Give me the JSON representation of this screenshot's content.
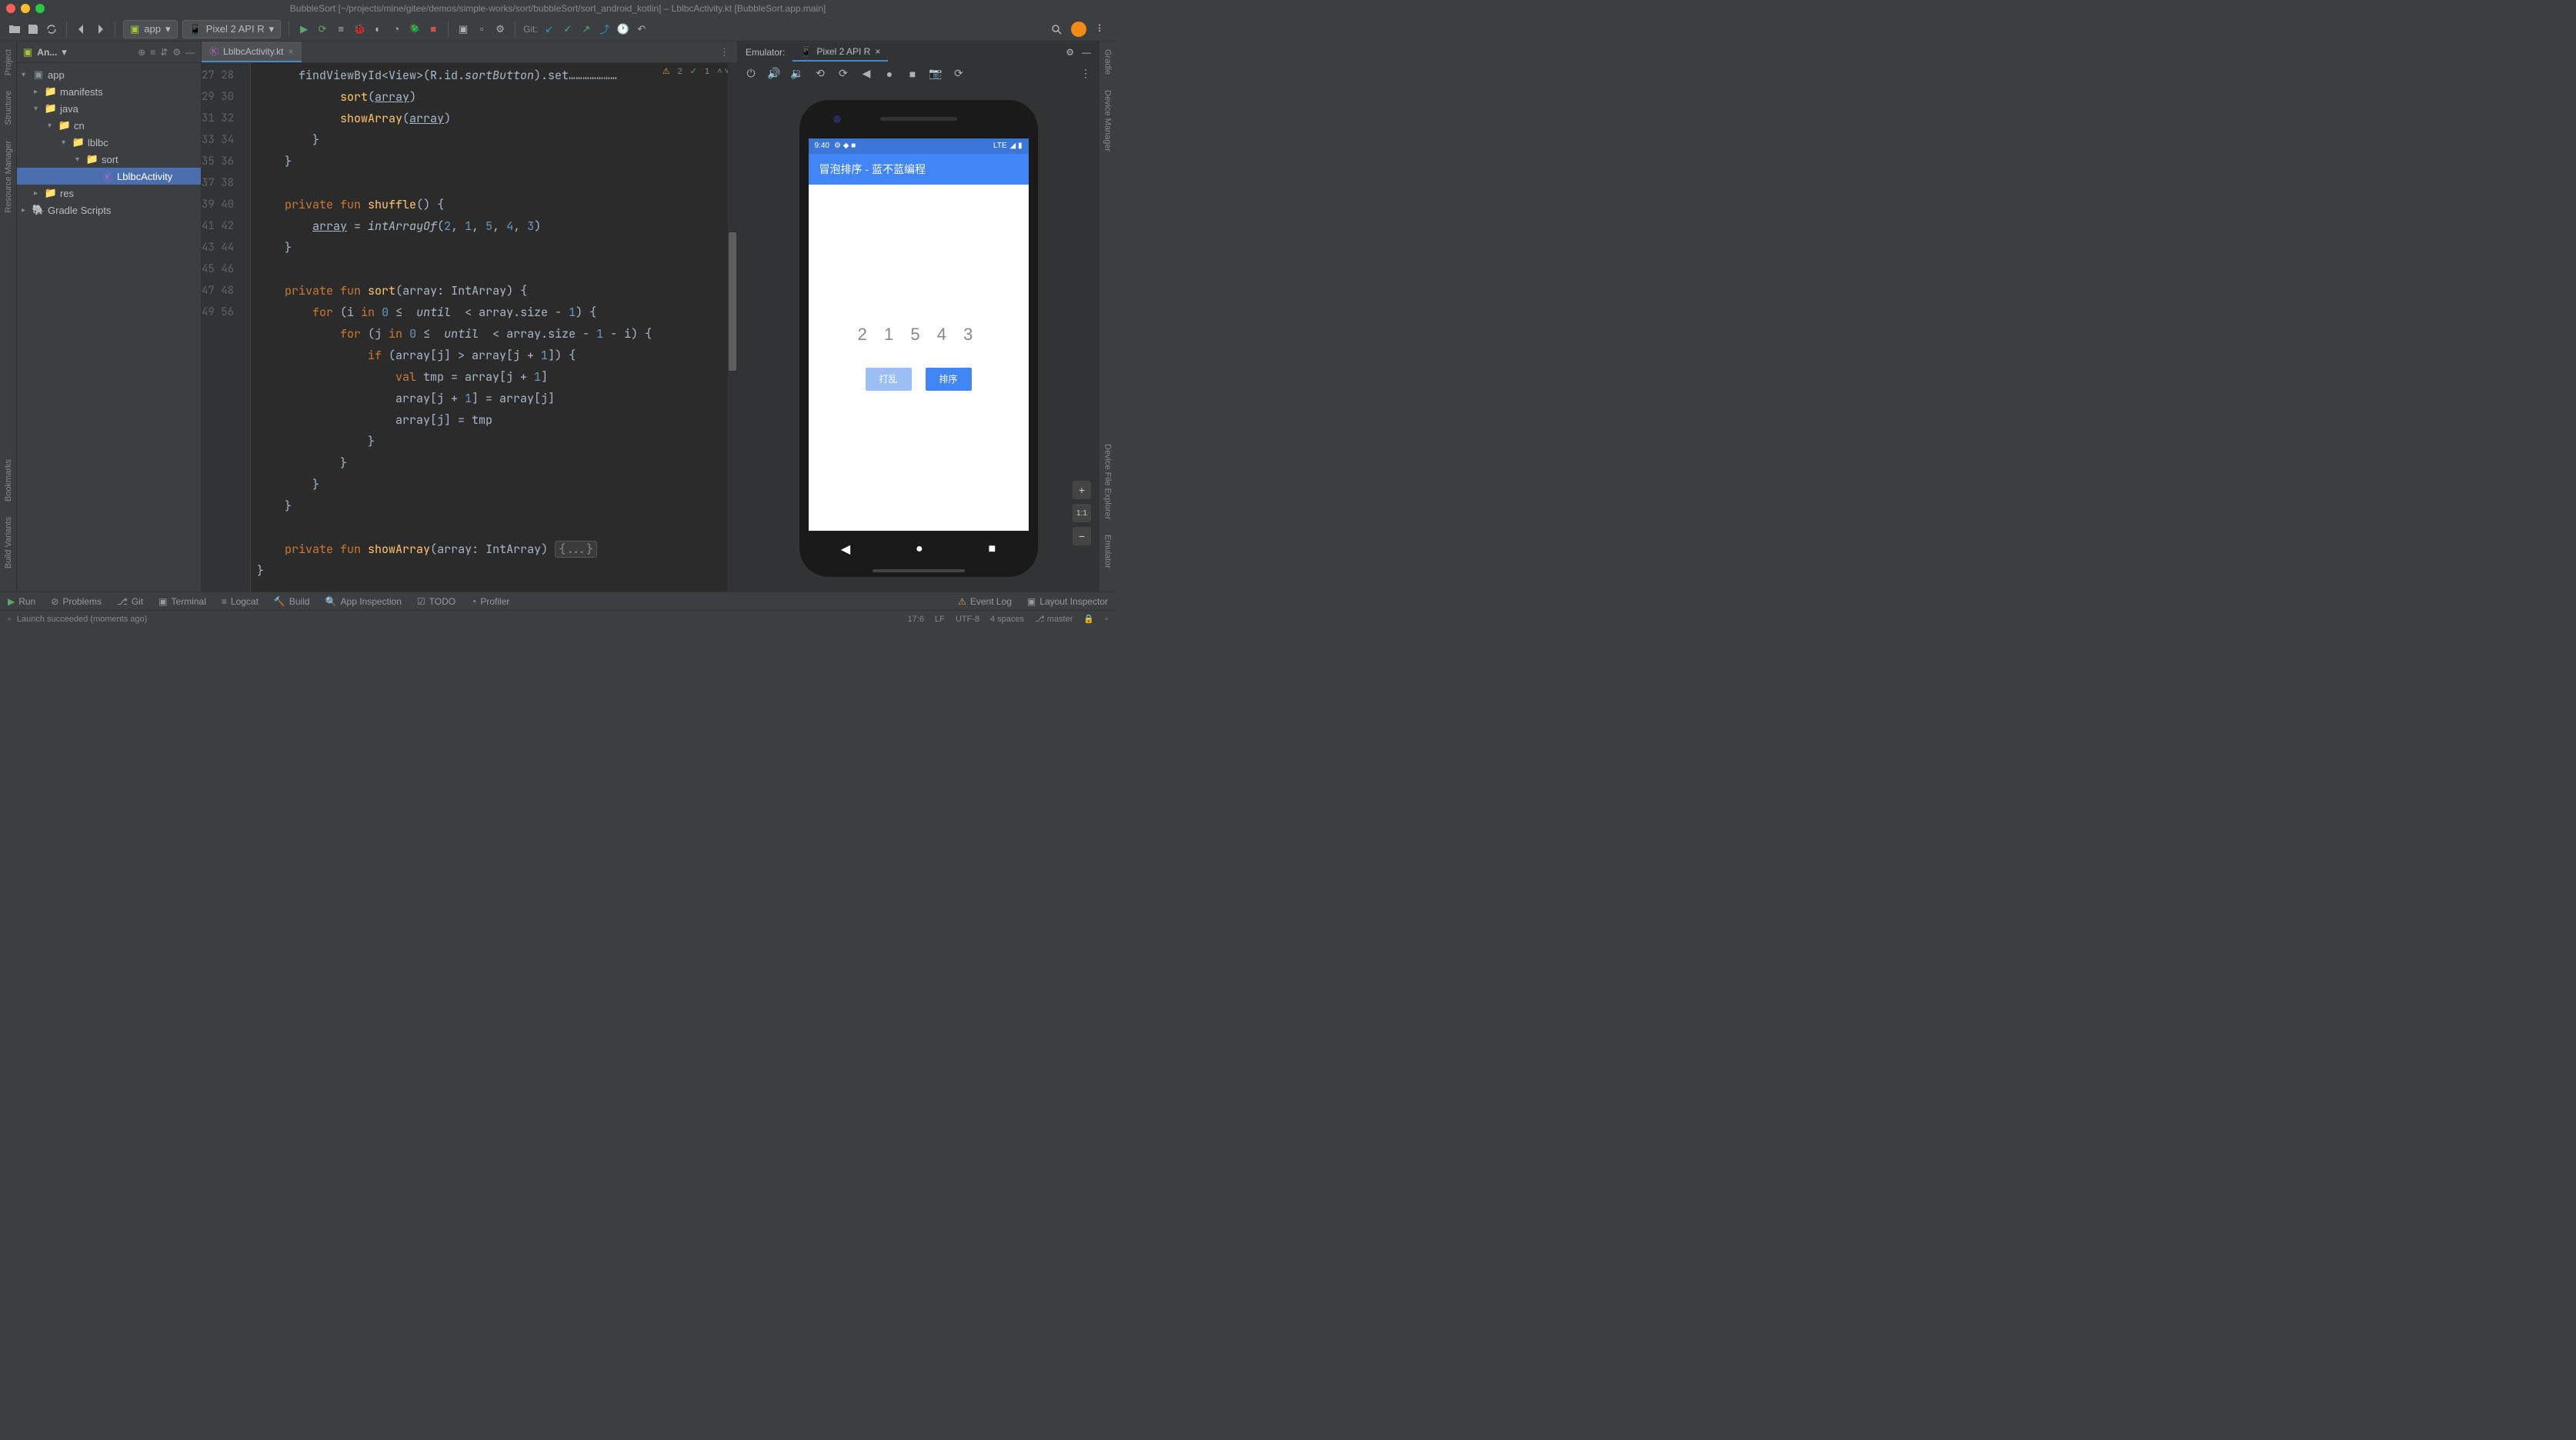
{
  "window": {
    "title": "BubbleSort [~/projects/mine/gitee/demos/simple-works/sort/bubbleSort/sort_android_kotlin] – LblbcActivity.kt [BubbleSort.app.main]"
  },
  "toolbar": {
    "run_config": "app",
    "device": "Pixel 2 API R",
    "git_label": "Git:"
  },
  "project_panel": {
    "title": "An...",
    "tree": {
      "app": "app",
      "manifests": "manifests",
      "java": "java",
      "cn": "cn",
      "lblbc": "lblbc",
      "sort": "sort",
      "activity": "LblbcActivity",
      "res": "res",
      "gradle": "Gradle Scripts"
    }
  },
  "editor": {
    "tab": "LblbcActivity.kt",
    "inspection_warn": "2",
    "inspection_ok": "1",
    "lines": {
      "start": 27,
      "labels": [
        "27",
        "28",
        "29",
        "30",
        "31",
        "32",
        "33",
        "34",
        "35",
        "36",
        "37",
        "38",
        "39",
        "40",
        "41",
        "42",
        "43",
        "44",
        "45",
        "46",
        "47",
        "48",
        "49",
        "56"
      ]
    }
  },
  "emulator": {
    "label": "Emulator:",
    "tab": "Pixel 2 API R"
  },
  "phone": {
    "time": "9:40",
    "signal": "LTE",
    "app_title": "冒泡排序 - 蓝不蓝编程",
    "numbers": "2 1 5 4 3",
    "btn_shuffle": "打乱",
    "btn_sort": "排序"
  },
  "bottom": {
    "run": "Run",
    "problems": "Problems",
    "git": "Git",
    "terminal": "Terminal",
    "logcat": "Logcat",
    "build": "Build",
    "app_inspection": "App Inspection",
    "todo": "TODO",
    "profiler": "Profiler",
    "event_log": "Event Log",
    "layout_inspector": "Layout Inspector"
  },
  "status": {
    "message": "Launch succeeded (moments ago)",
    "line_col": "17:6",
    "line_sep": "LF",
    "encoding": "UTF-8",
    "indent": "4 spaces",
    "branch": "master"
  },
  "left_gutter": {
    "project": "Project",
    "structure": "Structure",
    "resource_mgr": "Resource Manager",
    "bookmarks": "Bookmarks",
    "build_variants": "Build Variants"
  },
  "right_gutter": {
    "gradle": "Gradle",
    "device_mgr": "Device Manager",
    "device_file": "Device File Explorer",
    "emulator": "Emulator"
  }
}
